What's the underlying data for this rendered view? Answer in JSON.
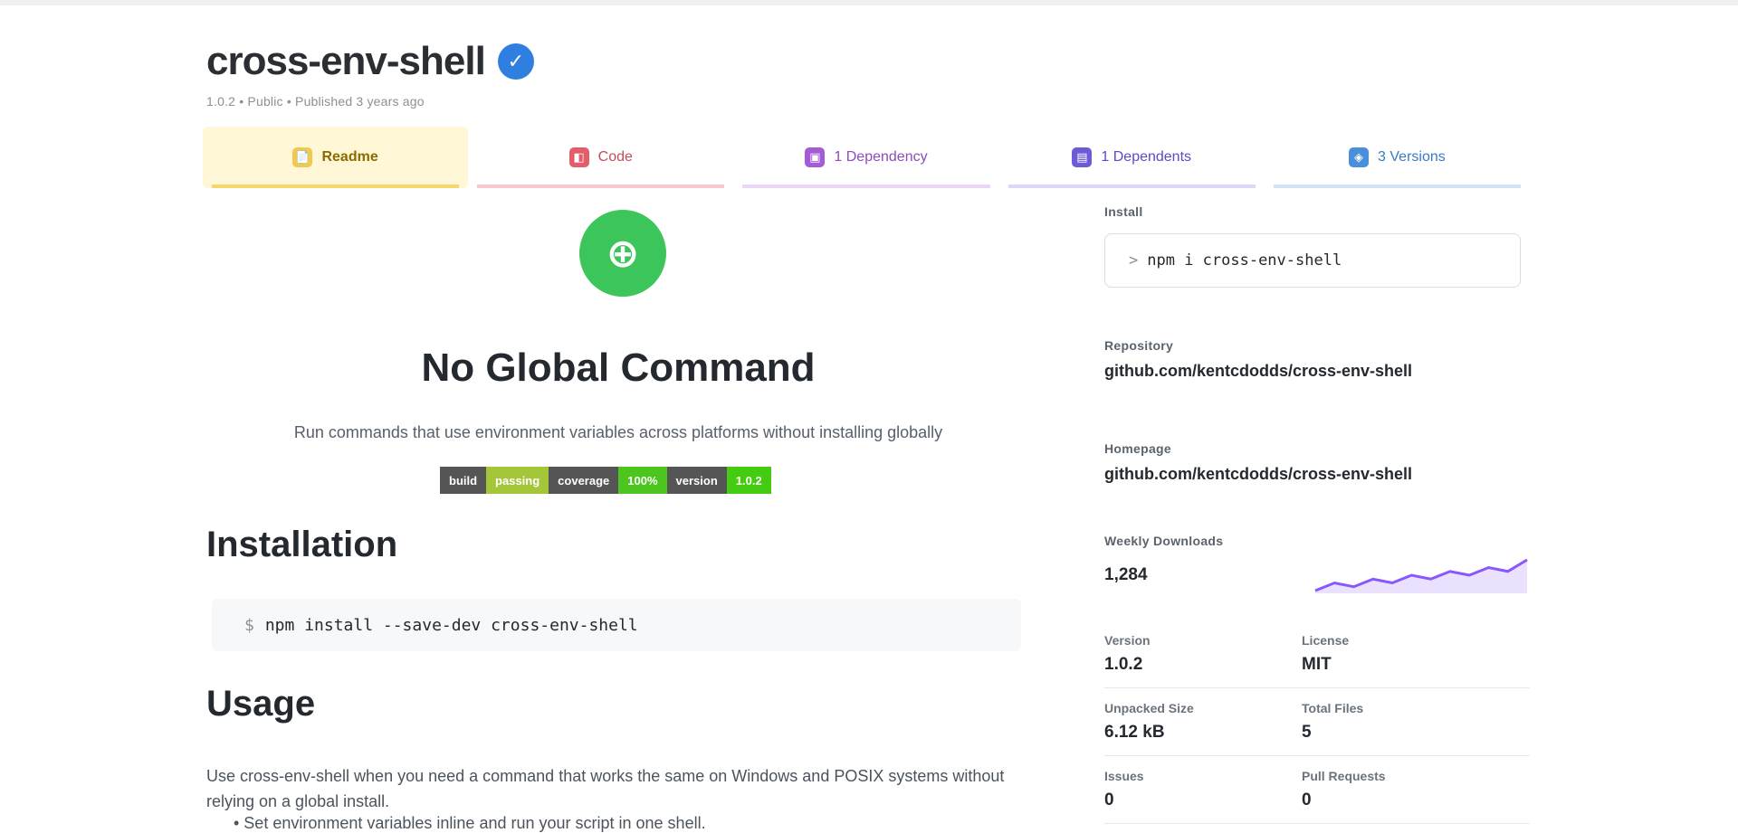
{
  "package": {
    "name": "cross-env-shell",
    "verified_mark": "✓",
    "meta": "1.0.2 • Public • Published 3 years ago"
  },
  "tabs": [
    {
      "label": "Readme",
      "icon": "📄"
    },
    {
      "label": "Code",
      "icon": "◧"
    },
    {
      "label": "1 Dependency",
      "icon": "▣"
    },
    {
      "label": "1 Dependents",
      "icon": "▤"
    },
    {
      "label": "3 Versions",
      "icon": "◈"
    }
  ],
  "readme": {
    "logo_glyph": "⊕",
    "title": "No Global Command",
    "description": "Run commands that use environment variables across platforms without installing globally",
    "badges": [
      {
        "key": "build",
        "value": "passing"
      },
      {
        "key": "coverage",
        "value": "100%"
      },
      {
        "key": "version",
        "value": "1.0.2"
      }
    ],
    "install_heading": "Installation",
    "install_command": "npm install --save-dev cross-env-shell",
    "prompt": "$",
    "usage_heading": "Usage",
    "usage_text": "Use cross-env-shell when you need a command that works the same on Windows and POSIX systems without relying on a global install.",
    "usage_text2": "• Set environment variables inline and run your script in one shell."
  },
  "sidebar": {
    "install_label": "Install",
    "install_chevron": ">",
    "install_command": "npm i cross-env-shell",
    "repo_label": "Repository",
    "repo_value": "github.com/kentcdodds/cross-env-shell",
    "home_label": "Homepage",
    "home_value": "github.com/kentcdodds/cross-env-shell",
    "downloads_label": "Weekly Downloads",
    "downloads_value": "1,284",
    "spark_color": "#8956ff",
    "spark_values": [
      4,
      6,
      5,
      7,
      6,
      8,
      7,
      9,
      8,
      10,
      9,
      12
    ],
    "stats": [
      [
        {
          "label": "Version",
          "value": "1.0.2"
        },
        {
          "label": "License",
          "value": "MIT"
        }
      ],
      [
        {
          "label": "Unpacked Size",
          "value": "6.12 kB"
        },
        {
          "label": "Total Files",
          "value": "5"
        }
      ],
      [
        {
          "label": "Issues",
          "value": "0"
        },
        {
          "label": "Pull Requests",
          "value": "0"
        }
      ]
    ]
  }
}
